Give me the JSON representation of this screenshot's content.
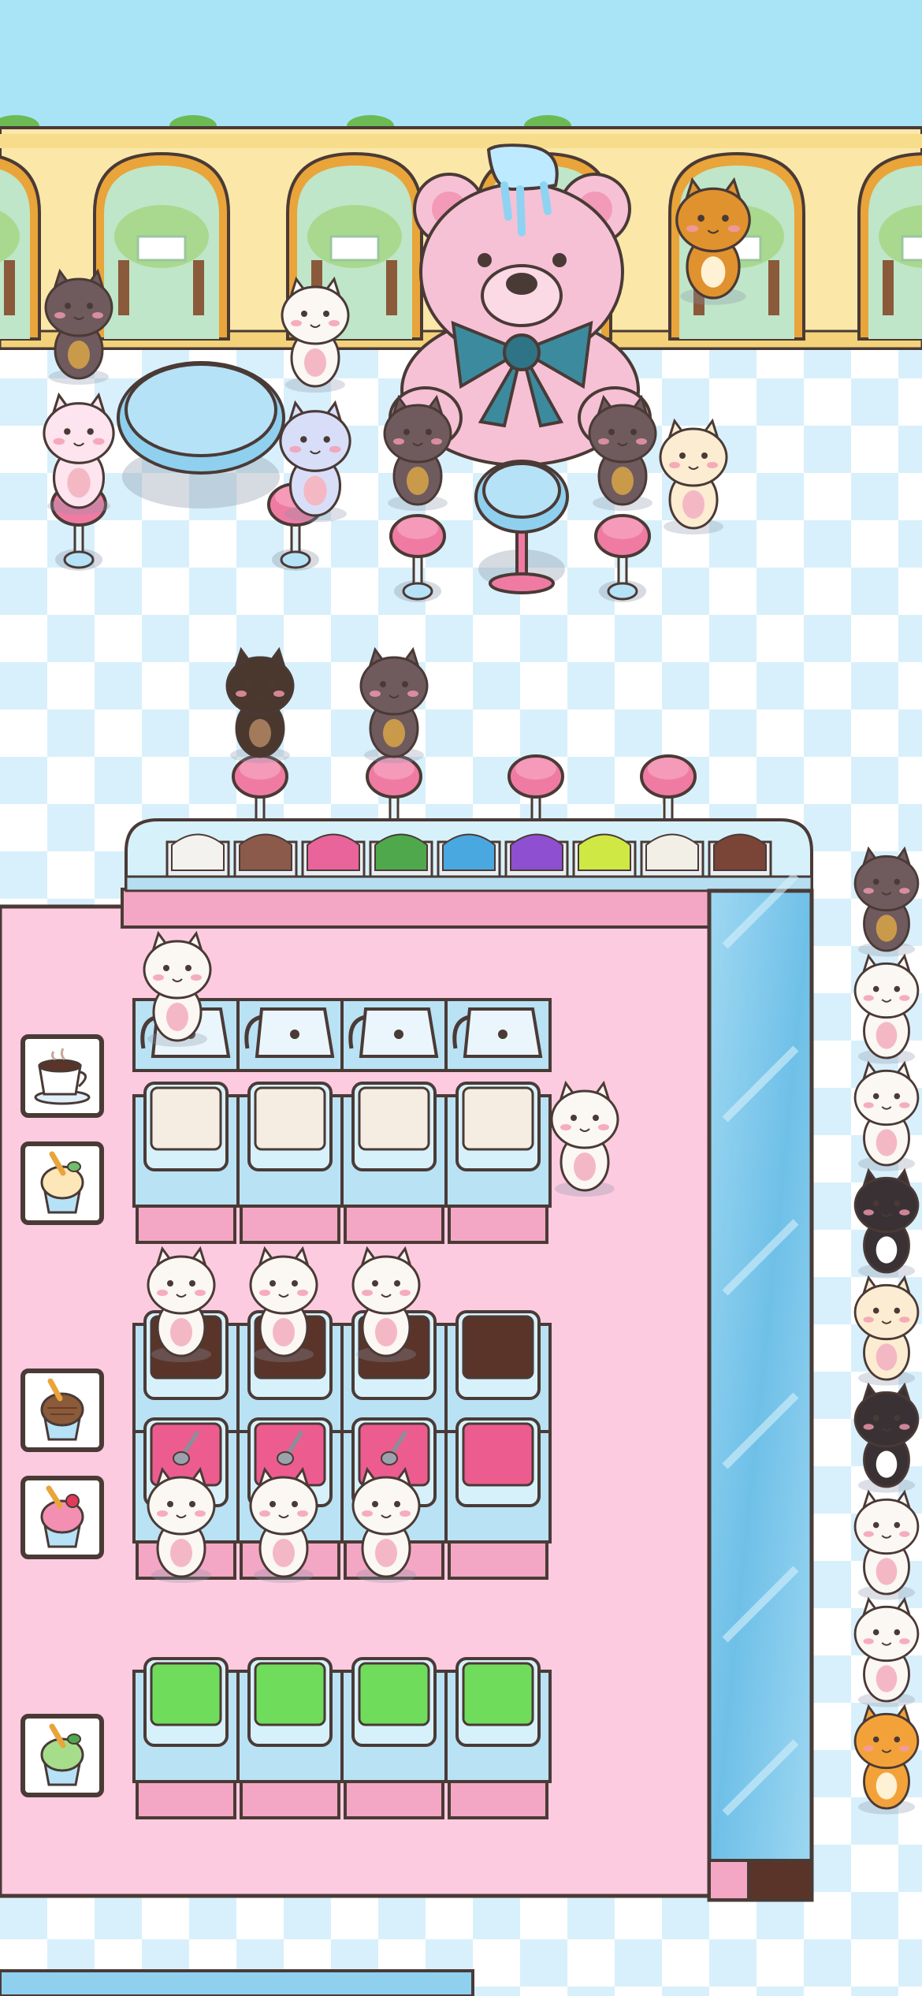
{
  "game": {
    "scene": "ice-cream-parlor",
    "colors": {
      "sky": "#a9e4f6",
      "wall": "#fbe7a8",
      "arch": "#e9a43a",
      "floor_light": "#ffffff",
      "floor_tile": "#d8f0fb",
      "kitchen_floor": "#fdcbe0",
      "counter_glass": "#7fc9ec",
      "seat_pink": "#ef7ba3",
      "bear_pink": "#f6c1d5",
      "bow_teal": "#3c8a9e",
      "outline": "#4a3a36"
    },
    "display_flavors": [
      "#f4f2ee",
      "#8b5a4a",
      "#e8649a",
      "#4fa84c",
      "#4aa8e0",
      "#8e4fd0",
      "#cfe843",
      "#f1efe6",
      "#7a4436"
    ],
    "stations": [
      {
        "id": "coffee",
        "icon": "coffee-cup-icon",
        "machine": "coffee-pot",
        "units": 4
      },
      {
        "id": "vanilla",
        "icon": "vanilla-ice-cream-icon",
        "machine": "vanilla-tub",
        "units": 4
      },
      {
        "id": "chocolate",
        "icon": "chocolate-ice-cream-icon",
        "machine": "chocolate-tub",
        "units": 4
      },
      {
        "id": "strawberry",
        "icon": "strawberry-ice-cream-icon",
        "machine": "strawberry-tub",
        "units": 4
      },
      {
        "id": "matcha",
        "icon": "matcha-ice-cream-icon",
        "machine": "matcha-tub",
        "units": 4
      }
    ],
    "station_colors": {
      "vanilla": "#f6ede2",
      "chocolate": "#5a3429",
      "strawberry": "#ec5c8f",
      "matcha": "#6fdc5c"
    },
    "queue": [
      "fox",
      "cat-white",
      "cat-white",
      "cat-tux",
      "cat-cream",
      "cat-tux",
      "cat-white",
      "cat-white",
      "cat-orange"
    ]
  }
}
